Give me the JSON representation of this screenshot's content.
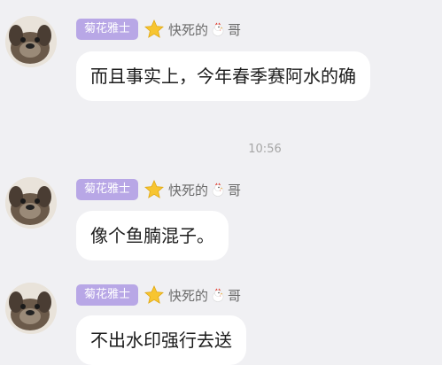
{
  "messages": [
    {
      "badge": "菊花雅士",
      "nickname": "快死的",
      "nickname_suffix": "哥",
      "text": "而且事实上，今年春季赛阿水的确"
    },
    {
      "badge": "菊花雅士",
      "nickname": "快死的",
      "nickname_suffix": "哥",
      "text": "像个鱼腩混子。"
    },
    {
      "badge": "菊花雅士",
      "nickname": "快死的",
      "nickname_suffix": "哥",
      "text": "不出水印强行去送"
    }
  ],
  "timestamp": "10:56",
  "colors": {
    "background": "#f0f0f3",
    "badge": "#b8a7e6",
    "bubble": "#ffffff",
    "timestamp": "#a6a6a6"
  },
  "icons": [
    "user-avatar",
    "star-icon",
    "chicken-icon"
  ]
}
